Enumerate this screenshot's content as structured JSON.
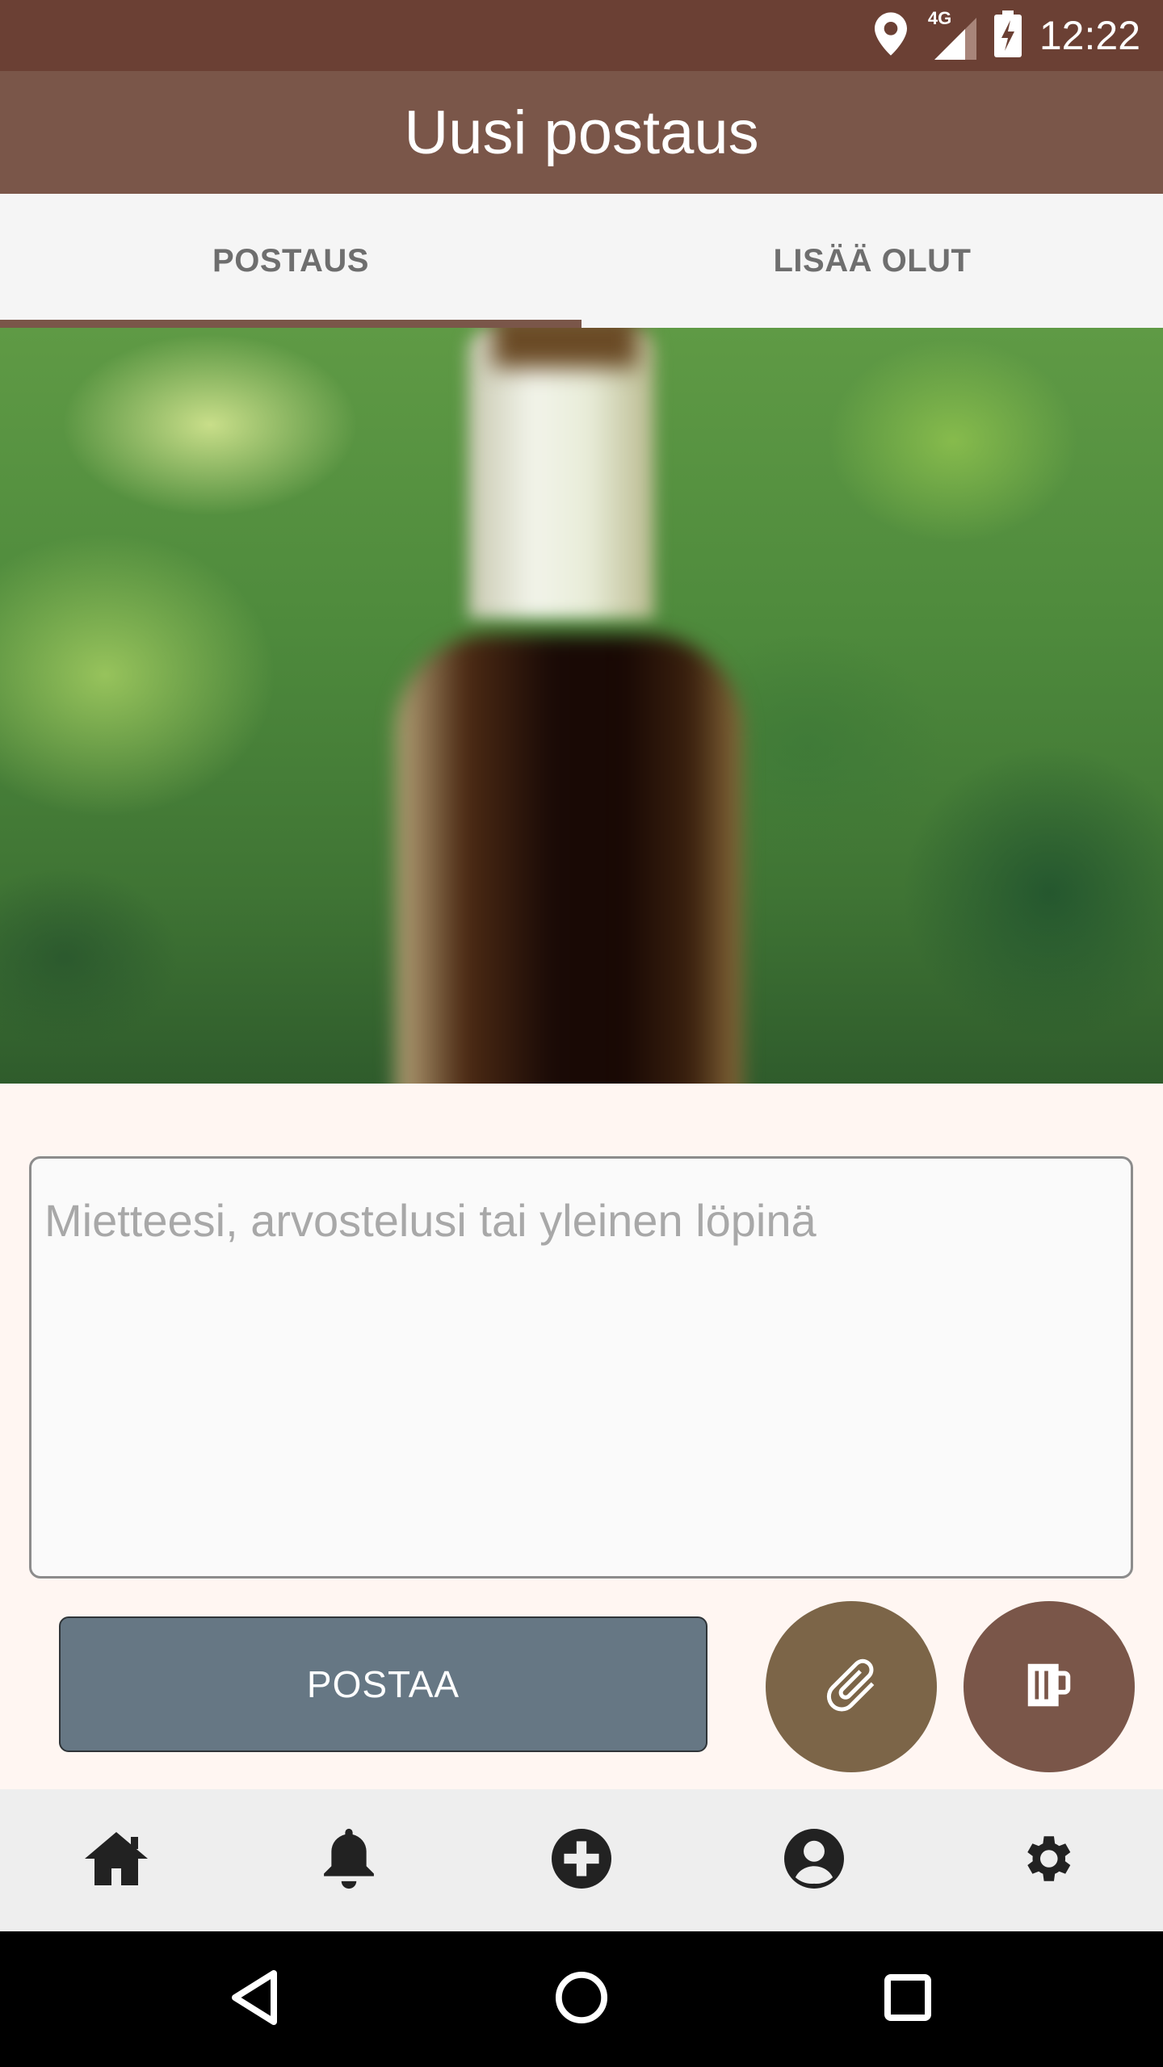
{
  "status_bar": {
    "time": "12:22",
    "network_label": "4G",
    "icons": [
      "location-icon",
      "signal-icon",
      "battery-charging-icon"
    ]
  },
  "app_bar": {
    "title": "Uusi postaus"
  },
  "tabs": [
    {
      "label": "POSTAUS",
      "active": true
    },
    {
      "label": "LISÄÄ OLUT",
      "active": false
    }
  ],
  "composer": {
    "placeholder": "Mietteesi, arvostelusi tai yleinen löpinä",
    "value": ""
  },
  "actions": {
    "post_label": "POSTAA",
    "attach_icon": "paperclip-icon",
    "beer_icon": "beer-mug-icon"
  },
  "bottom_nav": {
    "items": [
      "home-icon",
      "bell-icon",
      "add-circle-icon",
      "account-icon",
      "settings-icon"
    ]
  },
  "system_nav": {
    "buttons": [
      "back-icon",
      "home-circle-icon",
      "recents-square-icon"
    ]
  },
  "colors": {
    "status_bar": "#6b4034",
    "app_bar": "#7a5649",
    "tab_indicator": "#7a5649",
    "post_button": "#667784",
    "attach_fab": "#7c6548",
    "beer_fab": "#7a5649",
    "page_bg": "#fff6f2"
  }
}
